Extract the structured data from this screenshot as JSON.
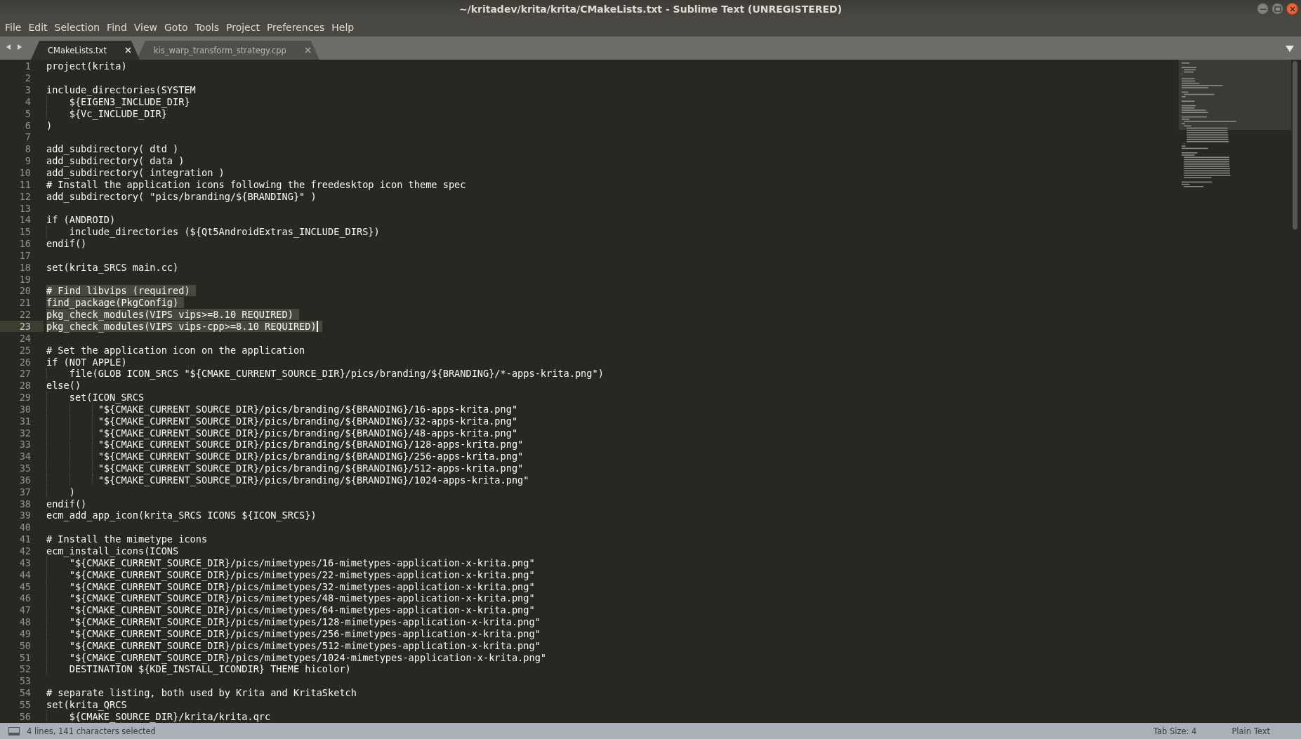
{
  "window": {
    "title": "~/kritadev/krita/krita/CMakeLists.txt - Sublime Text (UNREGISTERED)"
  },
  "menu": [
    "File",
    "Edit",
    "Selection",
    "Find",
    "View",
    "Goto",
    "Tools",
    "Project",
    "Preferences",
    "Help"
  ],
  "tabs": [
    {
      "label": "CMakeLists.txt",
      "selected": true
    },
    {
      "label": "kis_warp_transform_strategy.cpp",
      "selected": false
    }
  ],
  "editor": {
    "lines": [
      {
        "number": "1",
        "text": "project(krita)",
        "selected": false,
        "current": false
      },
      {
        "number": "2",
        "selected": false,
        "current": false
      },
      {
        "number": "3",
        "text": "include_directories(SYSTEM",
        "selected": false,
        "current": false
      },
      {
        "number": "4",
        "text": "    ${EIGEN3_INCLUDE_DIR}",
        "selected": false,
        "current": false
      },
      {
        "number": "5",
        "text": "    ${Vc_INCLUDE_DIR}",
        "selected": false,
        "current": false
      },
      {
        "number": "6",
        "text": ")",
        "selected": false,
        "current": false
      },
      {
        "number": "7",
        "selected": false,
        "current": false
      },
      {
        "number": "8",
        "text": "add_subdirectory( dtd )",
        "selected": false,
        "current": false
      },
      {
        "number": "9",
        "text": "add_subdirectory( data )",
        "selected": false,
        "current": false
      },
      {
        "number": "10",
        "text": "add_subdirectory( integration )",
        "selected": false,
        "current": false
      },
      {
        "number": "11",
        "text": "# Install the application icons following the freedesktop icon theme spec",
        "selected": false,
        "current": false
      },
      {
        "number": "12",
        "text": "add_subdirectory( \"pics/branding/${BRANDING}\" )",
        "selected": false,
        "current": false
      },
      {
        "number": "13",
        "selected": false,
        "current": false
      },
      {
        "number": "14",
        "text": "if (ANDROID)",
        "selected": false,
        "current": false
      },
      {
        "number": "15",
        "text": "    include_directories (${Qt5AndroidExtras_INCLUDE_DIRS})",
        "selected": false,
        "current": false
      },
      {
        "number": "16",
        "text": "endif()",
        "selected": false,
        "current": false
      },
      {
        "number": "17",
        "selected": false,
        "current": false
      },
      {
        "number": "18",
        "text": "set(krita_SRCS main.cc)",
        "selected": false,
        "current": false
      },
      {
        "number": "19",
        "selected": false,
        "current": false
      },
      {
        "number": "20",
        "text": "# Find libvips (required)",
        "selected": true,
        "current": false
      },
      {
        "number": "21",
        "text": "find_package(PkgConfig)",
        "selected": true,
        "current": false
      },
      {
        "number": "22",
        "text": "pkg_check_modules(VIPS vips>=8.10 REQUIRED)",
        "selected": true,
        "current": false
      },
      {
        "number": "23",
        "text": "pkg_check_modules(VIPS vips-cpp>=8.10 REQUIRED)",
        "selected": true,
        "current": true
      },
      {
        "number": "24",
        "selected": false,
        "current": false
      },
      {
        "number": "25",
        "text": "# Set the application icon on the application",
        "selected": false,
        "current": false
      },
      {
        "number": "26",
        "text": "if (NOT APPLE)",
        "selected": false,
        "current": false
      },
      {
        "number": "27",
        "text": "    file(GLOB ICON_SRCS \"${CMAKE_CURRENT_SOURCE_DIR}/pics/branding/${BRANDING}/*-apps-krita.png\")",
        "selected": false,
        "current": false
      },
      {
        "number": "28",
        "text": "else()",
        "selected": false,
        "current": false
      },
      {
        "number": "29",
        "text": "    set(ICON_SRCS",
        "selected": false,
        "current": false
      },
      {
        "number": "30",
        "text": "         \"${CMAKE_CURRENT_SOURCE_DIR}/pics/branding/${BRANDING}/16-apps-krita.png\"",
        "selected": false,
        "current": false
      },
      {
        "number": "31",
        "text": "         \"${CMAKE_CURRENT_SOURCE_DIR}/pics/branding/${BRANDING}/32-apps-krita.png\"",
        "selected": false,
        "current": false
      },
      {
        "number": "32",
        "text": "         \"${CMAKE_CURRENT_SOURCE_DIR}/pics/branding/${BRANDING}/48-apps-krita.png\"",
        "selected": false,
        "current": false
      },
      {
        "number": "33",
        "text": "         \"${CMAKE_CURRENT_SOURCE_DIR}/pics/branding/${BRANDING}/128-apps-krita.png\"",
        "selected": false,
        "current": false
      },
      {
        "number": "34",
        "text": "         \"${CMAKE_CURRENT_SOURCE_DIR}/pics/branding/${BRANDING}/256-apps-krita.png\"",
        "selected": false,
        "current": false
      },
      {
        "number": "35",
        "text": "         \"${CMAKE_CURRENT_SOURCE_DIR}/pics/branding/${BRANDING}/512-apps-krita.png\"",
        "selected": false,
        "current": false
      },
      {
        "number": "36",
        "text": "         \"${CMAKE_CURRENT_SOURCE_DIR}/pics/branding/${BRANDING}/1024-apps-krita.png\"",
        "selected": false,
        "current": false
      },
      {
        "number": "37",
        "text": "    )",
        "selected": false,
        "current": false
      },
      {
        "number": "38",
        "text": "endif()",
        "selected": false,
        "current": false
      },
      {
        "number": "39",
        "text": "ecm_add_app_icon(krita_SRCS ICONS ${ICON_SRCS})",
        "selected": false,
        "current": false
      },
      {
        "number": "40",
        "selected": false,
        "current": false
      },
      {
        "number": "41",
        "text": "# Install the mimetype icons",
        "selected": false,
        "current": false
      },
      {
        "number": "42",
        "text": "ecm_install_icons(ICONS",
        "selected": false,
        "current": false
      },
      {
        "number": "43",
        "text": "    \"${CMAKE_CURRENT_SOURCE_DIR}/pics/mimetypes/16-mimetypes-application-x-krita.png\"",
        "selected": false,
        "current": false
      },
      {
        "number": "44",
        "text": "    \"${CMAKE_CURRENT_SOURCE_DIR}/pics/mimetypes/22-mimetypes-application-x-krita.png\"",
        "selected": false,
        "current": false
      },
      {
        "number": "45",
        "text": "    \"${CMAKE_CURRENT_SOURCE_DIR}/pics/mimetypes/32-mimetypes-application-x-krita.png\"",
        "selected": false,
        "current": false
      },
      {
        "number": "46",
        "text": "    \"${CMAKE_CURRENT_SOURCE_DIR}/pics/mimetypes/48-mimetypes-application-x-krita.png\"",
        "selected": false,
        "current": false
      },
      {
        "number": "47",
        "text": "    \"${CMAKE_CURRENT_SOURCE_DIR}/pics/mimetypes/64-mimetypes-application-x-krita.png\"",
        "selected": false,
        "current": false
      },
      {
        "number": "48",
        "text": "    \"${CMAKE_CURRENT_SOURCE_DIR}/pics/mimetypes/128-mimetypes-application-x-krita.png\"",
        "selected": false,
        "current": false
      },
      {
        "number": "49",
        "text": "    \"${CMAKE_CURRENT_SOURCE_DIR}/pics/mimetypes/256-mimetypes-application-x-krita.png\"",
        "selected": false,
        "current": false
      },
      {
        "number": "50",
        "text": "    \"${CMAKE_CURRENT_SOURCE_DIR}/pics/mimetypes/512-mimetypes-application-x-krita.png\"",
        "selected": false,
        "current": false
      },
      {
        "number": "51",
        "text": "    \"${CMAKE_CURRENT_SOURCE_DIR}/pics/mimetypes/1024-mimetypes-application-x-krita.png\"",
        "selected": false,
        "current": false
      },
      {
        "number": "52",
        "text": "    DESTINATION ${KDE_INSTALL_ICONDIR} THEME hicolor)",
        "selected": false,
        "current": false
      },
      {
        "number": "53",
        "selected": false,
        "current": false
      },
      {
        "number": "54",
        "text": "# separate listing, both used by Krita and KritaSketch",
        "selected": false,
        "current": false
      },
      {
        "number": "55",
        "text": "set(krita_QRCS",
        "selected": false,
        "current": false
      },
      {
        "number": "56",
        "text": "    ${CMAKE_SOURCE_DIR}/krita/krita.qrc",
        "selected": false,
        "current": false
      }
    ]
  },
  "status_bar": {
    "selection": "4 lines, 141 characters selected",
    "tab_size": "Tab Size: 4",
    "syntax": "Plain Text"
  }
}
